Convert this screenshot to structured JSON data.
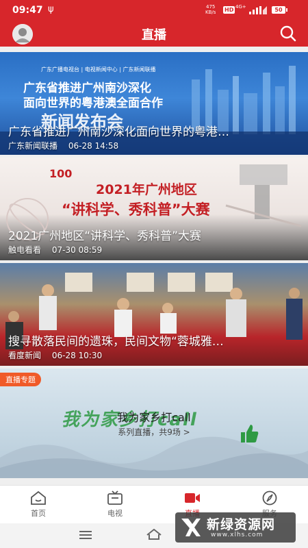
{
  "status_bar": {
    "time": "09:47",
    "usb_icon": "usb-icon",
    "net_rate_value": "475",
    "net_rate_unit": "KB/s",
    "hd_badge": "HD",
    "network_type": "4G+",
    "battery": "50"
  },
  "header": {
    "title": "直播",
    "avatar_icon": "user-avatar",
    "search_icon": "search-icon"
  },
  "cards": [
    {
      "banner_top": "广东广播电视台 | 电视新闻中心 | 广东新闻联播",
      "banner_line1": "广东省推进广州南沙深化",
      "banner_line2": "面向世界的粤港澳全面合作",
      "banner_line3": "新闻发布会",
      "caption": "广东省推进广州南沙深化面向世界的粤港…",
      "source": "广东新闻联播",
      "time": "06-28 14:58"
    },
    {
      "banner_logo": "100",
      "banner_line1": "2021年广州地区",
      "banner_line2": "“讲科学、秀科普”大赛",
      "caption": "2021广州地区“讲科学、秀科普”大赛",
      "source": "触电看看",
      "time": "07-30 08:59"
    },
    {
      "caption": "搜寻散落民间的遗珠，民间文物“蓉城雅…",
      "source": "看度新闻",
      "time": "06-28 10:30"
    },
    {
      "badge": "直播专题",
      "art_text": "我为家乡打call",
      "title": "我为家乡打call",
      "subtitle": "系列直播，共9场 >"
    }
  ],
  "tabs": [
    {
      "label": "首页",
      "icon": "home-icon",
      "active": false
    },
    {
      "label": "电视",
      "icon": "tv-icon",
      "active": false
    },
    {
      "label": "直播",
      "icon": "live-video-icon",
      "active": true
    },
    {
      "label": "服务",
      "icon": "compass-icon",
      "active": false
    }
  ],
  "nav_bar": {
    "menu_icon": "menu-icon",
    "home_icon": "home-nav-icon"
  },
  "watermark": {
    "name": "新绿资源网",
    "url": "www.xlhs.com"
  },
  "colors": {
    "brand_red": "#d7262b",
    "tab_inactive": "#666666",
    "badge_orange": "#f05a28",
    "call_green": "#2e9a44"
  }
}
